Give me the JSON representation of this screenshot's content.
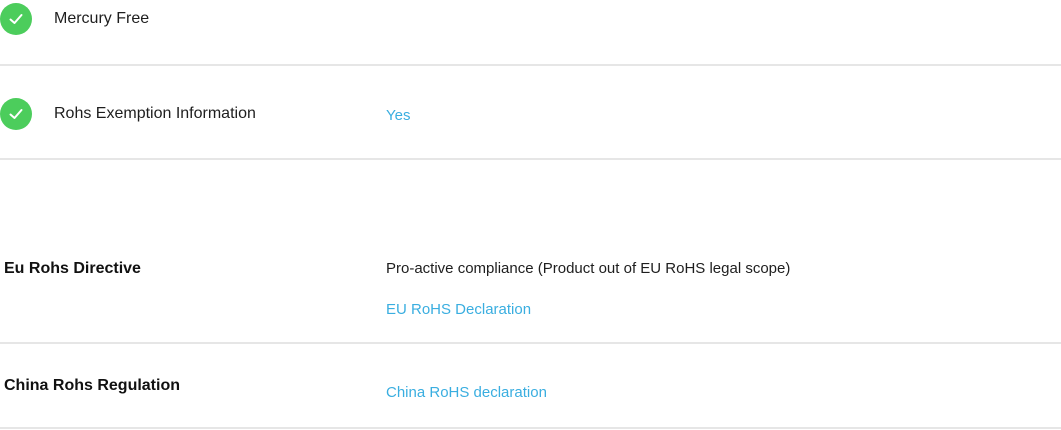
{
  "features": [
    {
      "label": "Mercury Free",
      "icon": "check-circle-icon",
      "value": ""
    },
    {
      "label": "Rohs Exemption Information",
      "icon": "check-circle-icon",
      "value": "Yes"
    }
  ],
  "compliance": [
    {
      "label": "Eu Rohs Directive",
      "text": "Pro-active compliance (Product out of EU RoHS legal scope)",
      "link": "EU RoHS Declaration"
    },
    {
      "label": "China Rohs Regulation",
      "link": "China RoHS declaration"
    }
  ],
  "colors": {
    "accent": "#3aaee0",
    "check": "#4ccd5c",
    "divider": "#e6e6e6"
  }
}
